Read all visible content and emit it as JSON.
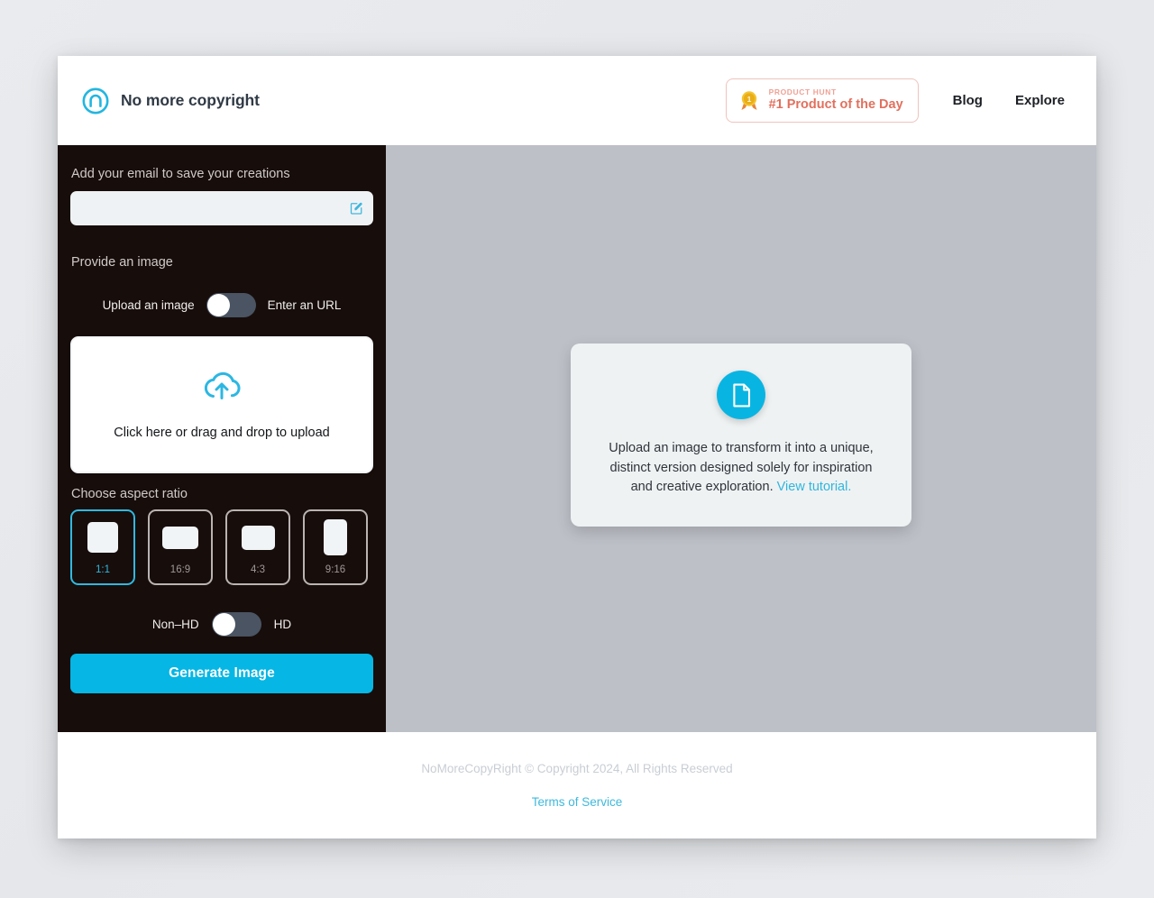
{
  "header": {
    "brand_name": "No more copyright",
    "logo_icon": "circle-arch-logo-icon",
    "badge": {
      "medal_icon": "gold-medal-icon",
      "kicker": "PRODUCT HUNT",
      "title": "#1 Product of the Day"
    },
    "nav": [
      {
        "label": "Blog"
      },
      {
        "label": "Explore"
      }
    ]
  },
  "sidebar": {
    "email_label": "Add your email to save your creations",
    "email_value": "",
    "email_placeholder": "",
    "email_edit_icon": "edit-pencil-square-icon",
    "provide_label": "Provide an image",
    "source_toggle": {
      "left_label": "Upload an image",
      "right_label": "Enter an URL",
      "state": "left"
    },
    "dropzone": {
      "icon": "cloud-upload-icon",
      "text": "Click here or drag and drop to upload"
    },
    "ratio_label": "Choose aspect ratio",
    "ratios": [
      {
        "label": "1:1",
        "selected": true
      },
      {
        "label": "16:9",
        "selected": false
      },
      {
        "label": "4:3",
        "selected": false
      },
      {
        "label": "9:16",
        "selected": false
      }
    ],
    "quality_toggle": {
      "left_label": "Non–HD",
      "right_label": "HD",
      "state": "left"
    },
    "generate_label": "Generate Image"
  },
  "canvas": {
    "card": {
      "icon": "document-file-icon",
      "text": "Upload an image to transform it into a unique, distinct version designed solely for inspiration and creative exploration. ",
      "link_label": "View tutorial."
    }
  },
  "footer": {
    "copyright": "NoMoreCopyRight © Copyright 2024, All Rights Reserved",
    "terms_label": "Terms of Service"
  },
  "colors": {
    "accent_cyan": "#06b6e4",
    "sidebar_bg": "#170d0b",
    "canvas_bg": "#bdc0c7",
    "badge_coral": "#e2705d",
    "toggle_track": "#4a5462"
  }
}
